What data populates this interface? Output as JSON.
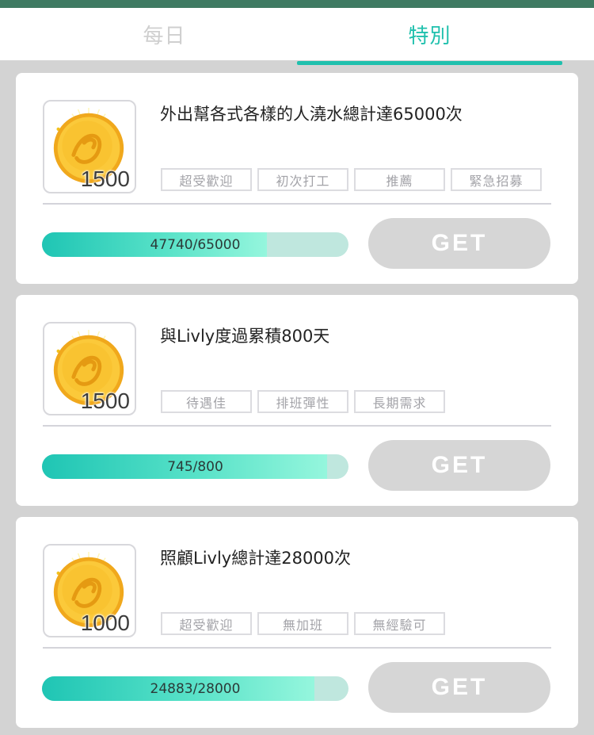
{
  "tabs": [
    {
      "label": "每日",
      "active": false
    },
    {
      "label": "特別",
      "active": true
    }
  ],
  "colors": {
    "accent": "#1fc0ad",
    "topbar": "#3f7a62",
    "disabled_button": "#d6d6d6"
  },
  "quests": [
    {
      "reward_icon": "gold-coin-icon",
      "reward": "1500",
      "title": "外出幫各式各樣的人澆水總計達65000次",
      "tags": [
        "超受歡迎",
        "初次打工",
        "推薦",
        "緊急招募"
      ],
      "progress_text": "47740/65000",
      "progress_current": 47740,
      "progress_total": 65000,
      "button": "GET"
    },
    {
      "reward_icon": "gold-coin-icon",
      "reward": "1500",
      "title": "與Livly度過累積800天",
      "tags": [
        "待遇佳",
        "排班彈性",
        "長期需求"
      ],
      "progress_text": "745/800",
      "progress_current": 745,
      "progress_total": 800,
      "button": "GET"
    },
    {
      "reward_icon": "gold-coin-icon",
      "reward": "1000",
      "title": "照顧Livly總計達28000次",
      "tags": [
        "超受歡迎",
        "無加班",
        "無經驗可"
      ],
      "progress_text": "24883/28000",
      "progress_current": 24883,
      "progress_total": 28000,
      "button": "GET"
    }
  ]
}
